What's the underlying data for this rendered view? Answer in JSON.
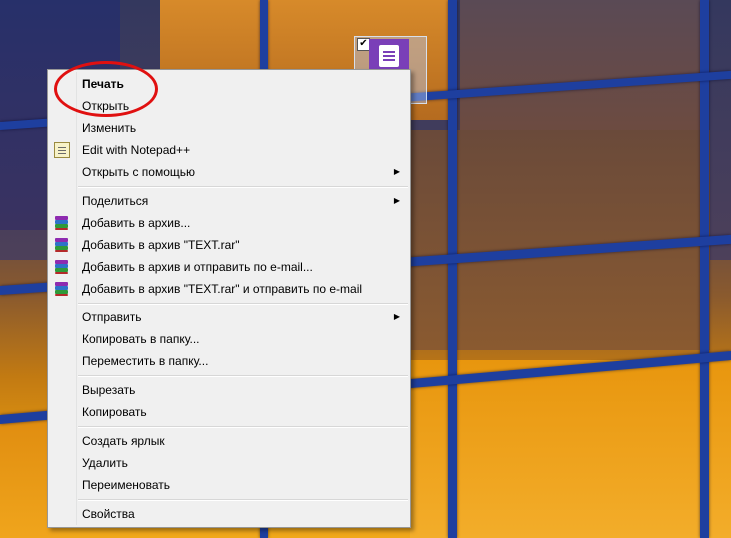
{
  "desktop": {
    "icon_name": "notepad-file-icon",
    "checkbox_checked": true
  },
  "context_menu": {
    "items": [
      {
        "label": "Печать",
        "bold": true
      },
      {
        "label": "Открыть"
      },
      {
        "label": "Изменить"
      },
      {
        "label": "Edit with Notepad++",
        "icon": "notepad-plus-plus-icon"
      },
      {
        "label": "Открыть с помощью",
        "submenu": true
      },
      {
        "label": "Поделиться",
        "submenu": true
      },
      {
        "label": "Добавить в архив...",
        "icon": "winrar-icon"
      },
      {
        "label": "Добавить в архив \"TEXT.rar\"",
        "icon": "winrar-icon"
      },
      {
        "label": "Добавить в архив и отправить по e-mail...",
        "icon": "winrar-icon"
      },
      {
        "label": "Добавить в архив \"TEXT.rar\" и отправить по e-mail",
        "icon": "winrar-icon"
      },
      {
        "label": "Отправить",
        "submenu": true
      },
      {
        "label": "Копировать в папку..."
      },
      {
        "label": "Переместить в папку..."
      },
      {
        "label": "Вырезать"
      },
      {
        "label": "Копировать"
      },
      {
        "label": "Создать ярлык"
      },
      {
        "label": "Удалить"
      },
      {
        "label": "Переименовать"
      },
      {
        "label": "Свойства"
      }
    ],
    "submenu_glyph": "▶"
  },
  "colors": {
    "annotation": "#e01010",
    "menu_background": "#f0f0f0",
    "window_frame": "#1e3f9f"
  }
}
